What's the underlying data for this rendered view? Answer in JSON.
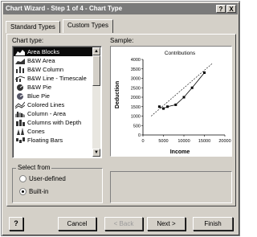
{
  "window": {
    "title": "Chart Wizard - Step 1 of 4 - Chart Type",
    "help_button": "?",
    "close_button": "X"
  },
  "tabs": [
    {
      "label": "Standard Types"
    },
    {
      "label": "Custom Types"
    }
  ],
  "chart_type": {
    "label": "Chart type:",
    "selected": "Area Blocks",
    "items": [
      {
        "label": "Area Blocks",
        "icon": "area-blocks-icon"
      },
      {
        "label": "B&W Area",
        "icon": "bw-area-icon"
      },
      {
        "label": "B&W Column",
        "icon": "bw-column-icon"
      },
      {
        "label": "B&W Line - Timescale",
        "icon": "bw-line-timescale-icon"
      },
      {
        "label": "B&W Pie",
        "icon": "bw-pie-icon"
      },
      {
        "label": "Blue Pie",
        "icon": "blue-pie-icon"
      },
      {
        "label": "Colored Lines",
        "icon": "colored-lines-icon"
      },
      {
        "label": "Column - Area",
        "icon": "column-area-icon"
      },
      {
        "label": "Columns with Depth",
        "icon": "columns-depth-icon"
      },
      {
        "label": "Cones",
        "icon": "cones-icon"
      },
      {
        "label": "Floating Bars",
        "icon": "floating-bars-icon"
      }
    ]
  },
  "sample": {
    "label": "Sample:",
    "chart_data": {
      "type": "line",
      "title": "Contributions",
      "xlabel": "Income",
      "ylabel": "Deduction",
      "x_ticks": [
        "0",
        "5000",
        "10000",
        "15000",
        "20000"
      ],
      "y_ticks": [
        "0",
        "500",
        "1000",
        "1500",
        "2000",
        "2500",
        "3000",
        "3500",
        "4000"
      ],
      "xlim": [
        0,
        20000
      ],
      "ylim": [
        0,
        4000
      ],
      "grid": false,
      "series": [
        {
          "x": [
            4000,
            5000,
            6000,
            8000,
            10000,
            12000,
            15000
          ],
          "y": [
            1500,
            1400,
            1500,
            1600,
            2000,
            2500,
            3300
          ],
          "trend_x": [
            2000,
            17000
          ],
          "trend_y": [
            1000,
            3800
          ]
        }
      ]
    }
  },
  "select_from": {
    "label": "Select from",
    "options": [
      {
        "label": "User-defined",
        "checked": false
      },
      {
        "label": "Built-in",
        "checked": true
      }
    ]
  },
  "buttons": {
    "help": "?",
    "cancel": "Cancel",
    "back": "< Back",
    "next": "Next >",
    "finish": "Finish"
  }
}
